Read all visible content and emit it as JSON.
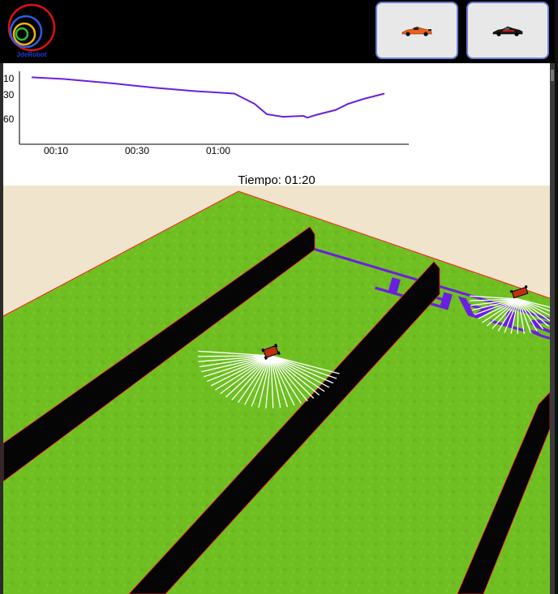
{
  "app": {
    "logo_text": "JdeRobot",
    "logo_icon": "jderobot-logo-icon"
  },
  "toolbar": {
    "buttons": [
      {
        "name": "orange-f1-car",
        "icon": "orange-car-icon",
        "color": "#e8601c"
      },
      {
        "name": "black-f1-car",
        "icon": "black-car-icon",
        "color": "#1a1a1a"
      }
    ]
  },
  "chart_data": {
    "type": "line",
    "x_ticks": [
      "00:10",
      "00:30",
      "01:00"
    ],
    "y_ticks": [
      "10",
      "30",
      "60"
    ],
    "series": [
      {
        "color": "#6a1fe0",
        "x": [
          0,
          8,
          20,
          30,
          40,
          50,
          55,
          58,
          62,
          67,
          68,
          70,
          75,
          78,
          82,
          87
        ],
        "y": [
          12,
          14,
          19,
          24,
          28,
          31,
          43,
          55,
          58,
          57,
          59,
          56,
          50,
          43,
          37,
          31
        ]
      }
    ],
    "xlim": [
      -3,
      93
    ],
    "ylim": [
      5,
      90
    ],
    "grid": false
  },
  "status": {
    "timer_label": "Tiempo: 01:20"
  },
  "scene": {
    "floor_text": "START",
    "grass_color": "#6fbf22",
    "ground_color": "#f1e4cc",
    "wall_color": "#050505",
    "border_color": "#ff1a1a",
    "line_color": "#6a1fe0"
  }
}
